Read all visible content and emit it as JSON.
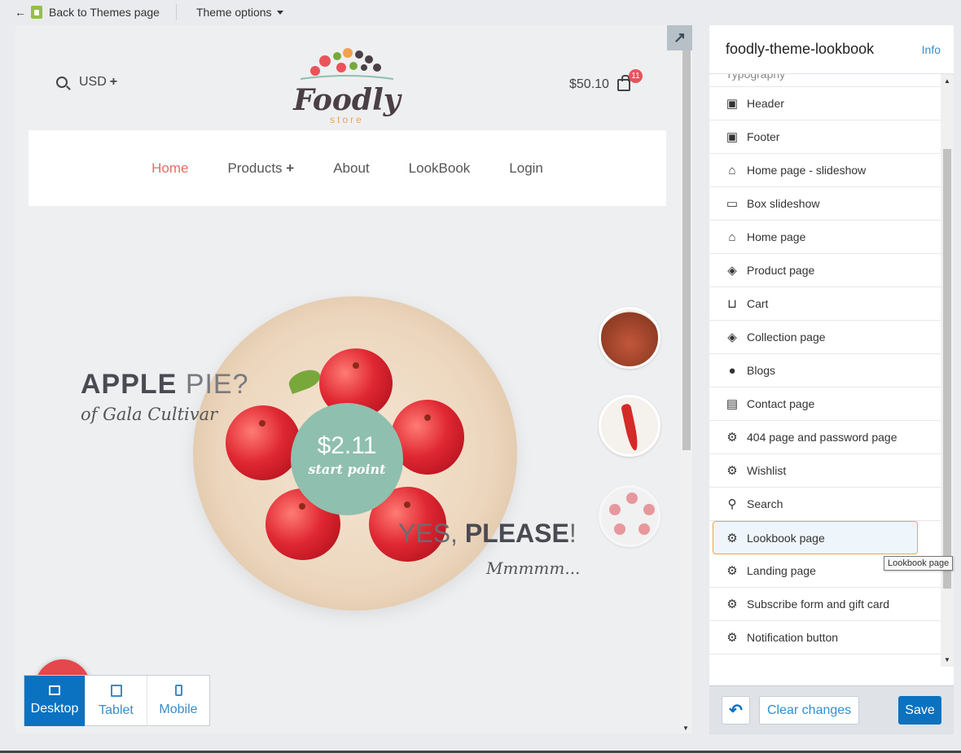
{
  "topbar": {
    "back_label": "Back to Themes page",
    "theme_options_label": "Theme options"
  },
  "store": {
    "currency": "USD",
    "logo_text": "Foodly",
    "logo_sub": "store",
    "cart_total": "$50.10",
    "cart_count": "11"
  },
  "nav": {
    "items": [
      "Home",
      "Products",
      "About",
      "LookBook",
      "Login"
    ]
  },
  "slide": {
    "title_bold": "APPLE",
    "title_light": "PIE?",
    "subtitle": "of Gala Cultivar",
    "price": "$2.11",
    "price_caption": "start point",
    "tag_light": "YES,",
    "tag_bold": "PLEASE",
    "tag_end": "!",
    "tag_sub": "Mmmmm..."
  },
  "devices": {
    "items": [
      "Desktop",
      "Tablet",
      "Mobile"
    ],
    "active": "Desktop"
  },
  "panel": {
    "title": "foodly-theme-lookbook",
    "info_label": "Info",
    "partial_item": "Typography",
    "items": [
      {
        "label": "Header",
        "icon": "header-icon"
      },
      {
        "label": "Footer",
        "icon": "footer-icon"
      },
      {
        "label": "Home page - slideshow",
        "icon": "home-icon"
      },
      {
        "label": "Box slideshow",
        "icon": "monitor-icon"
      },
      {
        "label": "Home page",
        "icon": "home-icon"
      },
      {
        "label": "Product page",
        "icon": "tag-icon"
      },
      {
        "label": "Cart",
        "icon": "cart-icon"
      },
      {
        "label": "Collection page",
        "icon": "tags-icon"
      },
      {
        "label": "Blogs",
        "icon": "chat-icon"
      },
      {
        "label": "Contact page",
        "icon": "contact-card-icon"
      },
      {
        "label": "404 page and password page",
        "icon": "gear-icon"
      },
      {
        "label": "Wishlist",
        "icon": "gear-icon"
      },
      {
        "label": "Search",
        "icon": "search-icon"
      },
      {
        "label": "Lookbook page",
        "icon": "gear-icon"
      },
      {
        "label": "Landing page",
        "icon": "gear-icon"
      },
      {
        "label": "Subscribe form and gift card",
        "icon": "gear-icon"
      },
      {
        "label": "Notification button",
        "icon": "gear-icon"
      }
    ],
    "selected": "Lookbook page",
    "tooltip": "Lookbook page"
  },
  "footer": {
    "clear_label": "Clear changes",
    "save_label": "Save"
  },
  "colors": {
    "accent": "#0a72c0",
    "nav_active": "#e76c5f",
    "price_circle": "#8fbfae",
    "selection_border": "#f2a14c"
  }
}
